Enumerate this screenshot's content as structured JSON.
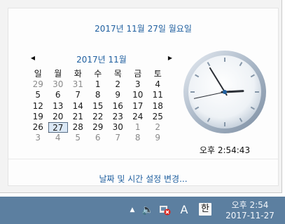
{
  "calendar": {
    "full_date": "2017년 11월 27일 월요일",
    "month_label": "2017년 11월",
    "prev_arrow": "◀",
    "next_arrow": "▶",
    "weekdays": [
      "일",
      "월",
      "화",
      "수",
      "목",
      "금",
      "토"
    ],
    "days": [
      [
        "29",
        "30",
        "31",
        "1",
        "2",
        "3",
        "4"
      ],
      [
        "5",
        "6",
        "7",
        "8",
        "9",
        "10",
        "11"
      ],
      [
        "12",
        "13",
        "14",
        "15",
        "16",
        "17",
        "18"
      ],
      [
        "19",
        "20",
        "21",
        "22",
        "23",
        "24",
        "25"
      ],
      [
        "26",
        "27",
        "28",
        "29",
        "30",
        "1",
        "2"
      ],
      [
        "3",
        "4",
        "5",
        "6",
        "7",
        "8",
        "9"
      ]
    ],
    "today": "27"
  },
  "clock": {
    "time_text": "오후 2:54:43",
    "hour": 2,
    "minute": 54,
    "second": 43
  },
  "settings_link": "날짜 및 시간 설정 변경...",
  "taskbar": {
    "tray_arrow": "▲",
    "volume_icon": "🔈",
    "network_icon": "⚠",
    "ime_label": "A",
    "hangul_label": "한",
    "time": "오후 2:54",
    "date": "2017-11-27"
  }
}
